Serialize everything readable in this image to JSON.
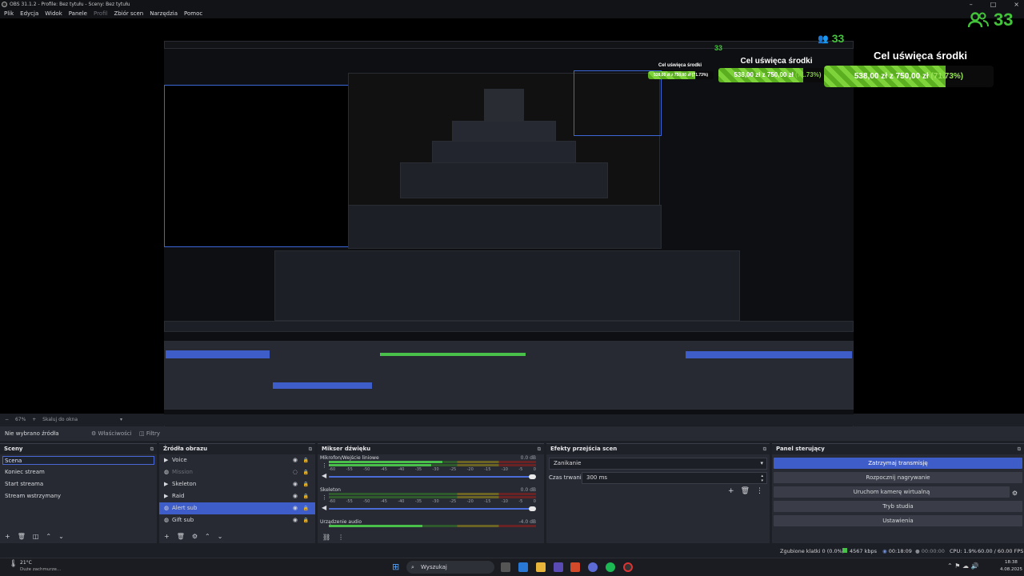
{
  "window": {
    "title": "OBS 31.1.2 - Profile: Bez tytułu - Sceny: Bez tytułu"
  },
  "menu": [
    {
      "label": "Plik",
      "disabled": false
    },
    {
      "label": "Edycja",
      "disabled": false
    },
    {
      "label": "Widok",
      "disabled": false
    },
    {
      "label": "Panele",
      "disabled": false
    },
    {
      "label": "Profil",
      "disabled": true
    },
    {
      "label": "Zbiór scen",
      "disabled": false
    },
    {
      "label": "Narzędzia",
      "disabled": false
    },
    {
      "label": "Pomoc",
      "disabled": false
    }
  ],
  "overlay": {
    "viewers": "33",
    "goal_title": "Cel uświęca środki",
    "goal_amount": "538,00 zł",
    "goal_sep": "z",
    "goal_target": "750,00 zł",
    "goal_percent": "(71.73%)",
    "goal_fraction": 0.7173,
    "accent": "#43c33a"
  },
  "zoom": {
    "level": "67%",
    "scale_label": "Skaluj do okna"
  },
  "source_toolbar": {
    "no_source": "Nie wybrano źródła",
    "properties": "Właściwości",
    "filters": "Filtry"
  },
  "scenes": {
    "title": "Sceny",
    "items": [
      "Scena",
      "Koniec stream",
      "Start streama",
      "Stream wstrzymany"
    ]
  },
  "sources": {
    "title": "Źródła obrazu",
    "items": [
      {
        "label": "Voice",
        "icon": "play-icon",
        "hidden": false,
        "selected": false
      },
      {
        "label": "Mission",
        "icon": "globe-icon",
        "hidden": true,
        "selected": false
      },
      {
        "label": "Skeleton",
        "icon": "play-icon",
        "hidden": false,
        "selected": false
      },
      {
        "label": "Raid",
        "icon": "play-icon",
        "hidden": false,
        "selected": false
      },
      {
        "label": "Alert sub",
        "icon": "globe-icon",
        "hidden": false,
        "selected": true
      },
      {
        "label": "Gift sub",
        "icon": "globe-icon",
        "hidden": false,
        "selected": false
      }
    ]
  },
  "mixer": {
    "title": "Mikser dźwięku",
    "ticks": [
      "-60",
      "-55",
      "-50",
      "-45",
      "-40",
      "-35",
      "-30",
      "-25",
      "-20",
      "-15",
      "-10",
      "-5",
      "0"
    ],
    "channels": [
      {
        "name": "Mikrofon/Wejście liniowe",
        "db": "0.0 dB",
        "level": 0.55
      },
      {
        "name": "Skeleton",
        "db": "0.0 dB",
        "level": 0.0
      },
      {
        "name": "Urządzenie audio",
        "db": "-4.0 dB",
        "level": 0.45
      }
    ]
  },
  "transitions": {
    "title": "Efekty przejścia scen",
    "type": "Zanikanie",
    "duration_label": "Czas trwania",
    "duration": "300 ms"
  },
  "controls": {
    "title": "Panel sterujący",
    "buttons": [
      "Zatrzymaj transmisję",
      "Rozpocznij nagrywanie",
      "Uruchom kamerę wirtualną",
      "Tryb studia",
      "Ustawienia"
    ]
  },
  "status": {
    "dropped": "Zgubione klatki 0 (0.0%)",
    "bitrate": "4567 kbps",
    "live_time": "00:18:09",
    "rec_time": "00:00:00",
    "cpu": "CPU: 1.9%",
    "fps": "60.00 / 60.00 FPS"
  },
  "taskbar": {
    "weather_temp": "21°C",
    "weather_text": "Duże zachmurze...",
    "search": "Wyszukaj",
    "time": "18:38",
    "date": "4.08.2025"
  }
}
